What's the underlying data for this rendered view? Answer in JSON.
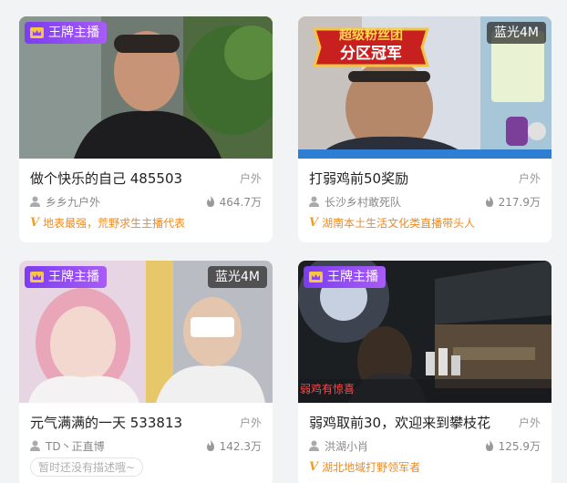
{
  "cards": [
    {
      "badge": "王牌主播",
      "title": "做个快乐的自己 485503",
      "category": "户外",
      "host": "乡乡九户外",
      "views": "464.7万",
      "tagline": "地表最强，荒野求生主播代表"
    },
    {
      "quality": "蓝光4M",
      "overlay_line1": "超级粉丝团",
      "overlay_line2": "分区冠军",
      "title": "打弱鸡前50奖励",
      "category": "户外",
      "host": "长沙乡村敢死队",
      "views": "217.9万",
      "tagline": "湖南本土生活文化类直播带头人"
    },
    {
      "badge": "王牌主播",
      "quality": "蓝光4M",
      "title": "元气满满的一天 533813",
      "category": "户外",
      "host": "TD丶正直博",
      "views": "142.3万",
      "empty_desc": "暂时还没有描述哦~"
    },
    {
      "badge": "王牌主播",
      "overlay_caption": "弱鸡有惊喜",
      "title": "弱鸡取前30，欢迎来到攀枝花",
      "category": "户外",
      "host": "洪湖小肖",
      "views": "125.9万",
      "tagline": "湖北地域打野领军者"
    }
  ],
  "colors": {
    "badge_purple": "#8a45f3",
    "tagline_orange": "#f08a20",
    "muted": "#888888"
  },
  "icons": {
    "badge": "crown-icon",
    "host": "user-icon",
    "views": "flame-icon",
    "tagline": "v-verified-icon"
  }
}
